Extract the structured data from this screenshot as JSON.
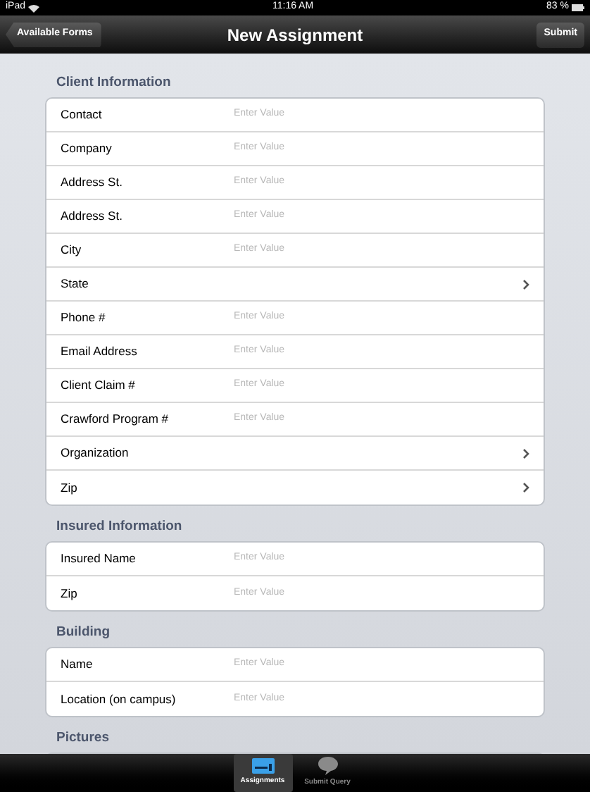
{
  "status_bar": {
    "device": "iPad",
    "time": "11:16 AM",
    "battery": "83 %"
  },
  "nav_bar": {
    "back_button": "Available Forms",
    "title": "New Assignment",
    "action_button": "Submit"
  },
  "sections": [
    {
      "title": "Client Information",
      "rows": [
        {
          "kind": "text",
          "label": "Contact",
          "placeholder": "Enter Value"
        },
        {
          "kind": "text",
          "label": "Company",
          "placeholder": "Enter Value"
        },
        {
          "kind": "text",
          "label": "Address St.",
          "placeholder": "Enter Value"
        },
        {
          "kind": "text",
          "label": "Address St.",
          "placeholder": "Enter Value"
        },
        {
          "kind": "text",
          "label": "City",
          "placeholder": "Enter Value"
        },
        {
          "kind": "picker",
          "label": "State"
        },
        {
          "kind": "text",
          "label": "Phone #",
          "placeholder": "Enter Value"
        },
        {
          "kind": "text",
          "label": "Email Address",
          "placeholder": "Enter Value"
        },
        {
          "kind": "text",
          "label": "Client Claim #",
          "placeholder": "Enter Value"
        },
        {
          "kind": "text",
          "label": "Crawford Program #",
          "placeholder": "Enter Value"
        },
        {
          "kind": "picker",
          "label": "Organization"
        },
        {
          "kind": "picker",
          "label": "Zip"
        }
      ]
    },
    {
      "title": "Insured Information",
      "rows": [
        {
          "kind": "text",
          "label": "Insured Name",
          "placeholder": "Enter Value"
        },
        {
          "kind": "text",
          "label": "Zip",
          "placeholder": "Enter Value"
        }
      ]
    },
    {
      "title": "Building",
      "rows": [
        {
          "kind": "text",
          "label": "Name",
          "placeholder": "Enter Value"
        },
        {
          "kind": "text",
          "label": "Location (on campus)",
          "placeholder": "Enter Value"
        }
      ]
    },
    {
      "title": "Pictures"
    }
  ],
  "tab_bar": [
    {
      "label": "Assignments",
      "kind": "card",
      "selected": true
    },
    {
      "label": "Submit Query",
      "kind": "bubble",
      "selected": false
    }
  ]
}
